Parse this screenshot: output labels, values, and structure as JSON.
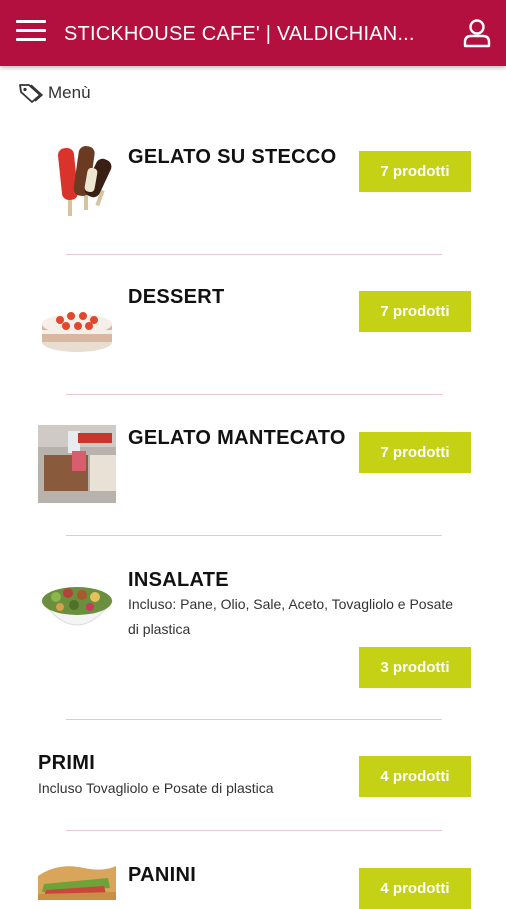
{
  "header": {
    "title": "STICKHOUSE CAFE' | VALDICHIAN...",
    "menu_icon": "hamburger-menu-icon",
    "user_icon": "user-icon"
  },
  "breadcrumb": {
    "icon": "tag-icon",
    "label": "Menù"
  },
  "colors": {
    "header_bg": "#b3103f",
    "count_button": "#c4d115",
    "separator": "#e7c7d0"
  },
  "categories": [
    {
      "name": "GELATO SU STECCO",
      "count": "7 prodotti"
    },
    {
      "name": "DESSERT",
      "count": "7 prodotti"
    },
    {
      "name": "GELATO MANTECATO",
      "count": "7 prodotti"
    },
    {
      "name": "INSALATE",
      "description": "Incluso: Pane, Olio, Sale, Aceto, Tovagliolo e Posate di plastica",
      "count": "3 prodotti"
    },
    {
      "name": "PRIMI",
      "description": "Incluso Tovagliolo e Posate di plastica",
      "count": "4 prodotti"
    },
    {
      "name": "PANINI",
      "count": "4 prodotti"
    }
  ]
}
